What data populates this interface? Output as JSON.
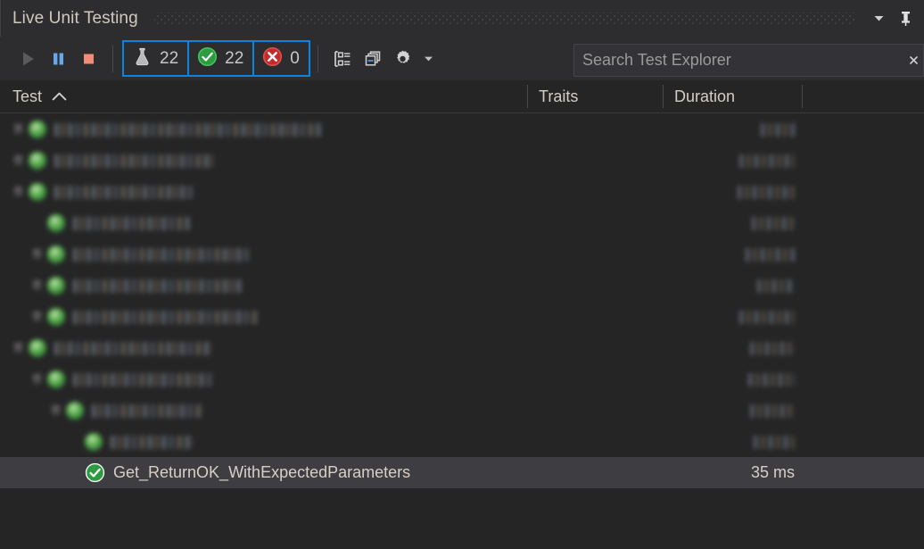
{
  "window": {
    "title": "Live Unit Testing",
    "dropdown_icon": "chevron-down-icon",
    "pin_icon": "pin-icon"
  },
  "toolbar": {
    "run_label": "Run",
    "run_icon": "play-icon",
    "pause_label": "Pause",
    "pause_icon": "pause-icon",
    "stop_label": "Stop",
    "stop_icon": "stop-icon",
    "group_by_label": "Group By",
    "group_by_icon": "group-by-icon",
    "collapse_all_label": "Collapse All",
    "collapse_all_icon": "collapse-all-icon",
    "settings_label": "Settings",
    "settings_icon": "gear-icon",
    "settings_dropdown_icon": "chevron-down-icon",
    "badges": [
      {
        "name": "total",
        "icon": "flask-icon",
        "count": "22",
        "active": true
      },
      {
        "name": "passed",
        "icon": "check-circle-icon",
        "count": "22",
        "active": true
      },
      {
        "name": "failed",
        "icon": "error-circle-icon",
        "count": "0",
        "active": true
      }
    ]
  },
  "search": {
    "placeholder": "Search Test Explorer",
    "value": "",
    "clear_icon": "clear-icon"
  },
  "columns": {
    "test": "Test",
    "traits": "Traits",
    "duration": "Duration",
    "sort_column": "Test",
    "sort_direction": "ascending",
    "sort_icon": "sort-ascending-icon"
  },
  "rows": [
    {
      "indent": 0,
      "expander": "collapsed",
      "status": "passed",
      "label": "",
      "redacted": true,
      "label_width": 300,
      "traits_width": 0,
      "duration": "",
      "duration_width": 38,
      "selected": false
    },
    {
      "indent": 0,
      "expander": "collapsed",
      "status": "passed",
      "label": "",
      "redacted": true,
      "label_width": 178,
      "traits_width": 0,
      "duration": "",
      "duration_width": 62,
      "selected": false
    },
    {
      "indent": 0,
      "expander": "expanded",
      "status": "passed",
      "label": "",
      "redacted": true,
      "label_width": 156,
      "traits_width": 0,
      "duration": "",
      "duration_width": 64,
      "selected": false
    },
    {
      "indent": 1,
      "expander": "none",
      "status": "passed",
      "label": "",
      "redacted": true,
      "label_width": 132,
      "traits_width": 0,
      "duration": "",
      "duration_width": 48,
      "selected": false
    },
    {
      "indent": 1,
      "expander": "collapsed",
      "status": "passed",
      "label": "",
      "redacted": true,
      "label_width": 198,
      "traits_width": 0,
      "duration": "",
      "duration_width": 55,
      "selected": false
    },
    {
      "indent": 1,
      "expander": "collapsed",
      "status": "passed",
      "label": "",
      "redacted": true,
      "label_width": 190,
      "traits_width": 0,
      "duration": "",
      "duration_width": 42,
      "selected": false
    },
    {
      "indent": 1,
      "expander": "collapsed",
      "status": "passed",
      "label": "",
      "redacted": true,
      "label_width": 208,
      "traits_width": 0,
      "duration": "",
      "duration_width": 62,
      "selected": false
    },
    {
      "indent": 0,
      "expander": "expanded",
      "status": "passed",
      "label": "",
      "redacted": true,
      "label_width": 176,
      "traits_width": 0,
      "duration": "",
      "duration_width": 50,
      "selected": false
    },
    {
      "indent": 1,
      "expander": "expanded",
      "status": "passed",
      "label": "",
      "redacted": true,
      "label_width": 158,
      "traits_width": 0,
      "duration": "",
      "duration_width": 52,
      "selected": false
    },
    {
      "indent": 2,
      "expander": "expanded",
      "status": "passed",
      "label": "",
      "redacted": true,
      "label_width": 126,
      "traits_width": 0,
      "duration": "",
      "duration_width": 50,
      "selected": false
    },
    {
      "indent": 3,
      "expander": "none",
      "status": "passed",
      "label": "",
      "redacted": true,
      "label_width": 92,
      "traits_width": 0,
      "duration": "",
      "duration_width": 46,
      "selected": false
    },
    {
      "indent": 3,
      "expander": "none",
      "status": "passed",
      "label": "Get_ReturnOK_WithExpectedParameters",
      "redacted": false,
      "label_width": 0,
      "traits_width": 0,
      "duration": "35 ms",
      "duration_width": 0,
      "selected": true
    }
  ],
  "colors": {
    "panel_bg": "#252526",
    "toolbar_bg": "#2d2d30",
    "accent_blue": "#0a84e0",
    "selection_bg": "#3e3e42",
    "text": "#d6cfc5",
    "pass_green": "#3fa34d",
    "fail_red": "#d13438",
    "pause_blue": "#68a8e8",
    "stop_red": "#f08c78"
  }
}
